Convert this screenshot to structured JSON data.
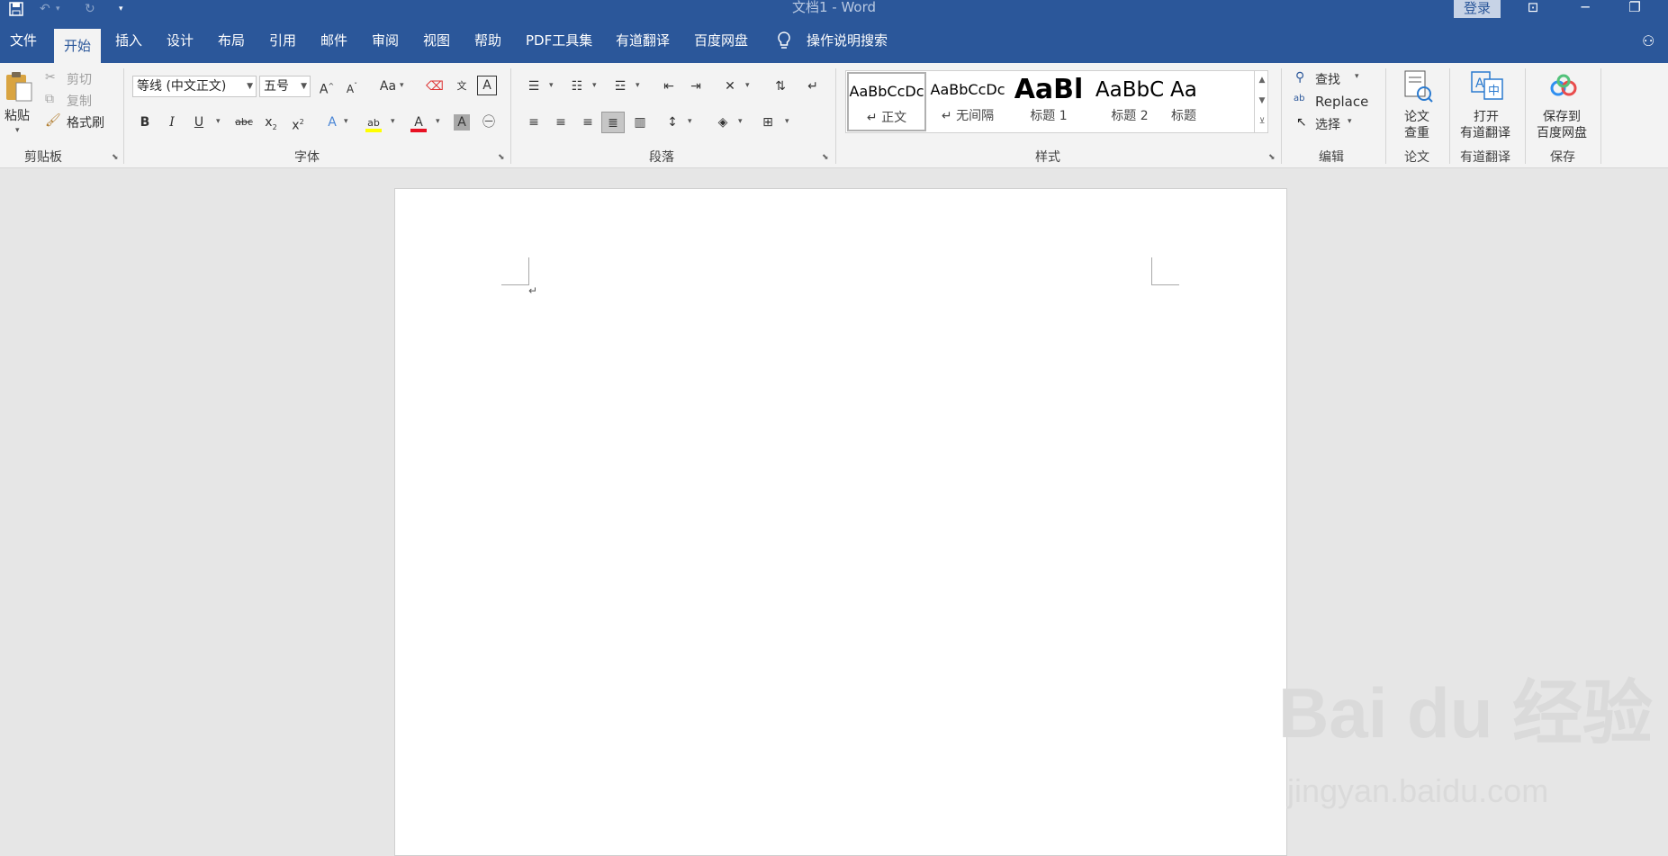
{
  "window": {
    "title": "文档1  -  Word",
    "login_label": "登录"
  },
  "tabs": [
    {
      "label": "文件"
    },
    {
      "label": "开始"
    },
    {
      "label": "插入"
    },
    {
      "label": "设计"
    },
    {
      "label": "布局"
    },
    {
      "label": "引用"
    },
    {
      "label": "邮件"
    },
    {
      "label": "审阅"
    },
    {
      "label": "视图"
    },
    {
      "label": "帮助"
    },
    {
      "label": "PDF工具集"
    },
    {
      "label": "有道翻译"
    },
    {
      "label": "百度网盘"
    }
  ],
  "tell_me": "操作说明搜索",
  "clipboard": {
    "paste": "粘贴",
    "cut": "剪切",
    "copy": "复制",
    "format_painter": "格式刷",
    "group_label": "剪贴板"
  },
  "font": {
    "name_value": "等线 (中文正文)",
    "size_value": "五号",
    "group_label": "字体"
  },
  "paragraph": {
    "group_label": "段落"
  },
  "styles": {
    "group_label": "样式",
    "items": [
      {
        "preview": "AaBbCcDc",
        "name": "↵ 正文"
      },
      {
        "preview": "AaBbCcDc",
        "name": "↵ 无间隔"
      },
      {
        "preview": "AaBl",
        "name": "标题 1"
      },
      {
        "preview": "AaBbC",
        "name": "标题 2"
      },
      {
        "preview": "AaBbC",
        "name": "标题"
      }
    ]
  },
  "editing": {
    "find": "查找",
    "replace": "Replace",
    "select": "选择",
    "group_label": "编辑"
  },
  "paper": {
    "button": "论文\n查重",
    "line1": "论文",
    "line2": "查重",
    "group_label": "论文"
  },
  "youdao": {
    "line1": "打开",
    "line2": "有道翻译",
    "group_label": "有道翻译"
  },
  "baidu": {
    "line1": "保存到",
    "line2": "百度网盘",
    "group_label": "保存"
  },
  "watermark": {
    "brand": "Bai du 经验",
    "url": "jingyan.baidu.com"
  },
  "colors": {
    "accent": "#2b579a",
    "font_color": "#e81123",
    "highlight": "#ffff00"
  }
}
